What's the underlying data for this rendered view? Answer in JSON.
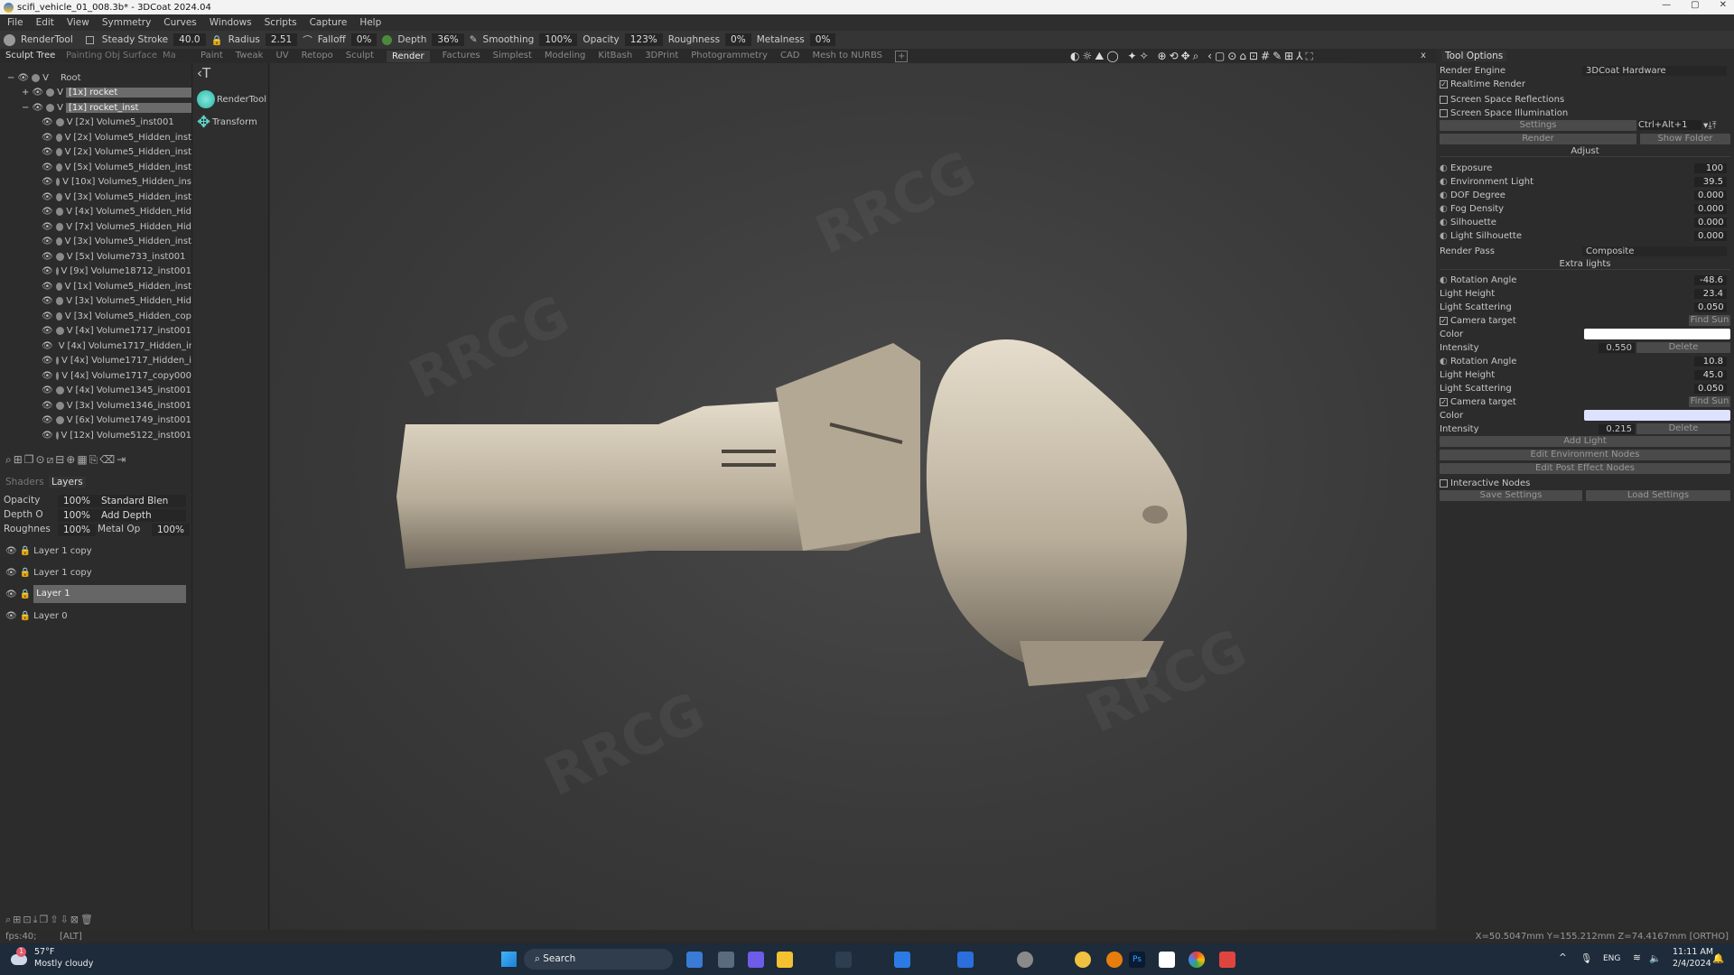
{
  "title": "scifi_vehicle_01_008.3b* - 3DCoat 2024.04",
  "menu": [
    "File",
    "Edit",
    "View",
    "Symmetry",
    "Curves",
    "Windows",
    "Scripts",
    "Capture",
    "Help"
  ],
  "toolbar": {
    "tool_name": "RenderTool",
    "steady_stroke": "Steady Stroke",
    "steady_stroke_value": "40.0",
    "radius": "Radius",
    "radius_value": "2.51",
    "falloff": "Falloff",
    "falloff_value": "0%",
    "depth": "Depth",
    "depth_value": "36%",
    "smoothing": "Smoothing",
    "smoothing_value": "100%",
    "opacity": "Opacity",
    "opacity_value": "123%",
    "roughness": "Roughness",
    "roughness_value": "0%",
    "metalness": "Metalness",
    "metalness_value": "0%"
  },
  "left_tabs": [
    "Sculpt Tree",
    "Painting",
    "Obj",
    "Surface",
    "Ma"
  ],
  "workspace_tabs": [
    "Paint",
    "Tweak",
    "UV",
    "Retopo",
    "Sculpt",
    "Render",
    "Factures",
    "Simplest",
    "Modeling",
    "KitBash",
    "3DPrint",
    "Photogrammetry",
    "CAD",
    "Mesh to NURBS"
  ],
  "active_workspace": "Render",
  "viewport_icons": "◐☼⛰◯ ✦✧ ⊕⟲✥⌕ ‹▢⊙⌂⊡#✎⊞⅄⛶",
  "close_label": "x",
  "tree": {
    "root": "Root",
    "items": [
      {
        "count": "[1x]",
        "name": "rocket",
        "level": 1,
        "expander": "+",
        "selected": true
      },
      {
        "count": "[1x]",
        "name": "rocket_inst",
        "level": 1,
        "expander": "−",
        "selected": true
      },
      {
        "count": "[2x]",
        "name": "Volume5_inst001",
        "level": 2
      },
      {
        "count": "[2x]",
        "name": "Volume5_Hidden_inst",
        "level": 2
      },
      {
        "count": "[2x]",
        "name": "Volume5_Hidden_inst",
        "level": 2
      },
      {
        "count": "[5x]",
        "name": "Volume5_Hidden_inst",
        "level": 2
      },
      {
        "count": "[10x]",
        "name": "Volume5_Hidden_ins",
        "level": 2
      },
      {
        "count": "[3x]",
        "name": "Volume5_Hidden_inst",
        "level": 2
      },
      {
        "count": "[4x]",
        "name": "Volume5_Hidden_Hid",
        "level": 2
      },
      {
        "count": "[7x]",
        "name": "Volume5_Hidden_Hid",
        "level": 2
      },
      {
        "count": "[3x]",
        "name": "Volume5_Hidden_inst",
        "level": 2
      },
      {
        "count": "[5x]",
        "name": "Volume733_inst001",
        "level": 2
      },
      {
        "count": "[9x]",
        "name": "Volume18712_inst001",
        "level": 2
      },
      {
        "count": "[1x]",
        "name": "Volume5_Hidden_inst",
        "level": 2
      },
      {
        "count": "[3x]",
        "name": "Volume5_Hidden_Hid",
        "level": 2
      },
      {
        "count": "[3x]",
        "name": "Volume5_Hidden_cop",
        "level": 2
      },
      {
        "count": "[4x]",
        "name": "Volume1717_inst001",
        "level": 2
      },
      {
        "count": "[4x]",
        "name": "Volume1717_Hidden_in",
        "level": 2
      },
      {
        "count": "[4x]",
        "name": "Volume1717_Hidden_i",
        "level": 2
      },
      {
        "count": "[4x]",
        "name": "Volume1717_copy000",
        "level": 2
      },
      {
        "count": "[4x]",
        "name": "Volume1345_inst001",
        "level": 2
      },
      {
        "count": "[3x]",
        "name": "Volume1346_inst001",
        "level": 2
      },
      {
        "count": "[6x]",
        "name": "Volume1749_inst001",
        "level": 2
      },
      {
        "count": "[12x]",
        "name": "Volume5122_inst001",
        "level": 2
      }
    ]
  },
  "tree_tools": "⌕⊞❐⊙⧄⊟⊕▦⎘⌫⇥",
  "layer_panel": {
    "tabs": [
      "Shaders",
      "Layers"
    ],
    "opacity_label": "Opacity",
    "opacity_value": "100%",
    "blend_mode": "Standard Blen",
    "depth_label": "Depth O",
    "depth_value": "100%",
    "depth_mode": "Add Depth",
    "roughness_label": "Roughnes",
    "roughness_value": "100%",
    "metal_label": "Metal Op",
    "metal_value": "100%",
    "layers": [
      {
        "name": "Layer 1 copy"
      },
      {
        "name": "Layer 1 copy"
      },
      {
        "name": "Layer 1",
        "selected": true
      },
      {
        "name": "Layer 0"
      }
    ],
    "bottom_tools": "⌕⊞⊡⤓❐⇧⇩⊠🗑"
  },
  "tools": [
    {
      "name": "RenderTool"
    },
    {
      "name": "Transform"
    }
  ],
  "tool_options": {
    "tab": "Tool Options",
    "render_engine_label": "Render Engine",
    "render_engine": "3DCoat Hardware",
    "realtime_render": "Realtime Render",
    "ssr": "Screen Space Reflections",
    "ssi": "Screen Space Illumination",
    "settings": "Settings",
    "shortcut": "Ctrl+Alt+1",
    "render": "Render",
    "show_folder": "Show Folder",
    "adjust": "Adjust",
    "adjust_rows": [
      {
        "label": "Exposure",
        "value": "100"
      },
      {
        "label": "Environment Light",
        "value": "39.5"
      },
      {
        "label": "DOF Degree",
        "value": "0.000"
      },
      {
        "label": "Fog Density",
        "value": "0.000"
      },
      {
        "label": "Silhouette",
        "value": "0.000"
      },
      {
        "label": "Light Silhouette",
        "value": "0.000"
      }
    ],
    "render_pass_label": "Render Pass",
    "render_pass": "Composite",
    "extra_lights": "Extra lights",
    "lights": [
      {
        "rotation": "-48.6",
        "height": "23.4",
        "scattering": "0.050",
        "intensity": "0.550",
        "color": "#ffffff"
      },
      {
        "rotation": "10.8",
        "height": "45.0",
        "scattering": "0.050",
        "intensity": "0.215",
        "color": "#dde3ff"
      }
    ],
    "rotation_label": "Rotation Angle",
    "height_label": "Light Height",
    "scattering_label": "Light Scattering",
    "camera_target": "Camera target",
    "find_sun": "Find Sun",
    "color_label": "Color",
    "intensity_label": "Intensity",
    "delete": "Delete",
    "add_light": "Add Light",
    "edit_env": "Edit Environment Nodes",
    "edit_post": "Edit Post Effect Nodes",
    "interactive_nodes": "Interactive Nodes",
    "save_settings": "Save Settings",
    "load_settings": "Load Settings"
  },
  "status": {
    "fps": "fps:40;",
    "mode": "[ALT]",
    "coords": "X=50.5047mm  Y=155.212mm  Z=74.4167mm  [ORTHO]"
  },
  "taskbar": {
    "temp": "57°F",
    "weather": "Mostly cloudy",
    "badge": "1",
    "search": "Search",
    "lang": "ENG",
    "time": "11:11 AM",
    "date": "2/4/2024"
  },
  "watermark": "RRCG"
}
